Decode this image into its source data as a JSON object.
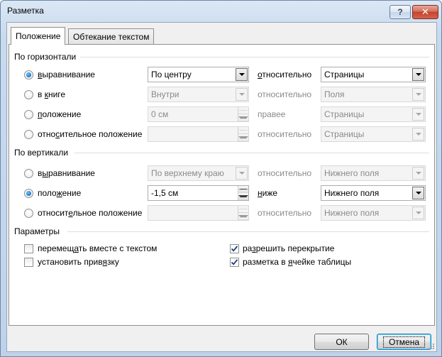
{
  "window": {
    "title": "Разметка",
    "help_label": "?",
    "close_label": "✕"
  },
  "tabs": [
    {
      "label": "Положение",
      "active": true
    },
    {
      "label": "Обтекание текстом",
      "active": false
    }
  ],
  "horizontal": {
    "group_label": "По горизонтали",
    "rows": [
      {
        "option_pre": "",
        "option_u": "в",
        "option_post": "ыравнивание",
        "checked": true,
        "value": "По центру",
        "value_type": "dropdown",
        "enabled": true,
        "rel_pre": "",
        "rel_u": "о",
        "rel_post": "тносительно",
        "rel_enabled": true,
        "target": "Страницы",
        "target_enabled": true
      },
      {
        "option_pre": "в ",
        "option_u": "к",
        "option_post": "ниге",
        "checked": false,
        "value": "Внутри",
        "value_type": "dropdown",
        "enabled": false,
        "rel_pre": "относительно",
        "rel_u": "",
        "rel_post": "",
        "rel_enabled": false,
        "target": "Поля",
        "target_enabled": false
      },
      {
        "option_pre": "",
        "option_u": "п",
        "option_post": "оложение",
        "checked": false,
        "value": "0 см",
        "value_type": "spin",
        "enabled": false,
        "rel_pre": "правее",
        "rel_u": "",
        "rel_post": "",
        "rel_enabled": false,
        "target": "Страницы",
        "target_enabled": false
      },
      {
        "option_pre": "отно",
        "option_u": "с",
        "option_post": "ительное положение",
        "checked": false,
        "value": "",
        "value_type": "spin",
        "enabled": false,
        "rel_pre": "относительно",
        "rel_u": "",
        "rel_post": "",
        "rel_enabled": false,
        "target": "Страницы",
        "target_enabled": false
      }
    ]
  },
  "vertical": {
    "group_label": "По вертикали",
    "rows": [
      {
        "option_pre": "в",
        "option_u": "ы",
        "option_post": "равнивание",
        "checked": false,
        "value": "По верхнему краю",
        "value_type": "dropdown",
        "enabled": false,
        "rel_pre": "относительно",
        "rel_u": "",
        "rel_post": "",
        "rel_enabled": false,
        "target": "Нижнего поля",
        "target_enabled": false
      },
      {
        "option_pre": "поло",
        "option_u": "ж",
        "option_post": "ение",
        "checked": true,
        "value": "-1,5 см",
        "value_type": "spin",
        "enabled": true,
        "rel_pre": "",
        "rel_u": "н",
        "rel_post": "иже",
        "rel_enabled": true,
        "target": "Нижнего поля",
        "target_enabled": true
      },
      {
        "option_pre": "относит",
        "option_u": "е",
        "option_post": "льное положение",
        "checked": false,
        "value": "",
        "value_type": "spin",
        "enabled": false,
        "rel_pre": "относительно",
        "rel_u": "",
        "rel_post": "",
        "rel_enabled": false,
        "target": "Нижнего поля",
        "target_enabled": false
      }
    ]
  },
  "params": {
    "group_label": "Параметры",
    "checkboxes": [
      {
        "pre": "перемещ",
        "u": "а",
        "post": "ть вместе с текстом",
        "checked": false
      },
      {
        "pre": "установить прив",
        "u": "я",
        "post": "зку",
        "checked": false
      },
      {
        "pre": "ра",
        "u": "з",
        "post": "решить перекрытие",
        "checked": true
      },
      {
        "pre": "разметка в ",
        "u": "я",
        "post": "чейке таблицы",
        "checked": true
      }
    ]
  },
  "buttons": {
    "ok": "ОК",
    "cancel": "Отмена"
  }
}
